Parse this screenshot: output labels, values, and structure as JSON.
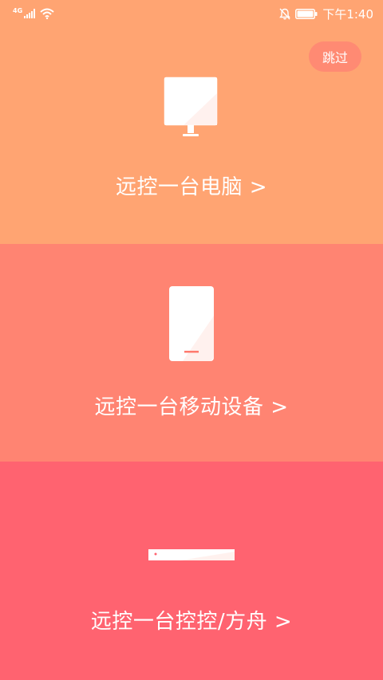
{
  "status_bar": {
    "network_type": "4G",
    "time": "下午1:40"
  },
  "skip": {
    "label": "跳过"
  },
  "sections": [
    {
      "label": "远控一台电脑 >",
      "icon": "monitor-icon"
    },
    {
      "label": "远控一台移动设备 >",
      "icon": "phone-icon"
    },
    {
      "label": "远控一台控控/方舟 >",
      "icon": "box-device-icon"
    }
  ],
  "colors": {
    "pc_bg": "#FFA472",
    "mobile_bg": "#FF8472",
    "box_bg": "#FF6370",
    "skip_bg": "#FF8A73",
    "icon_white": "#FFFFFF",
    "icon_accent": "#FF7A6E"
  }
}
